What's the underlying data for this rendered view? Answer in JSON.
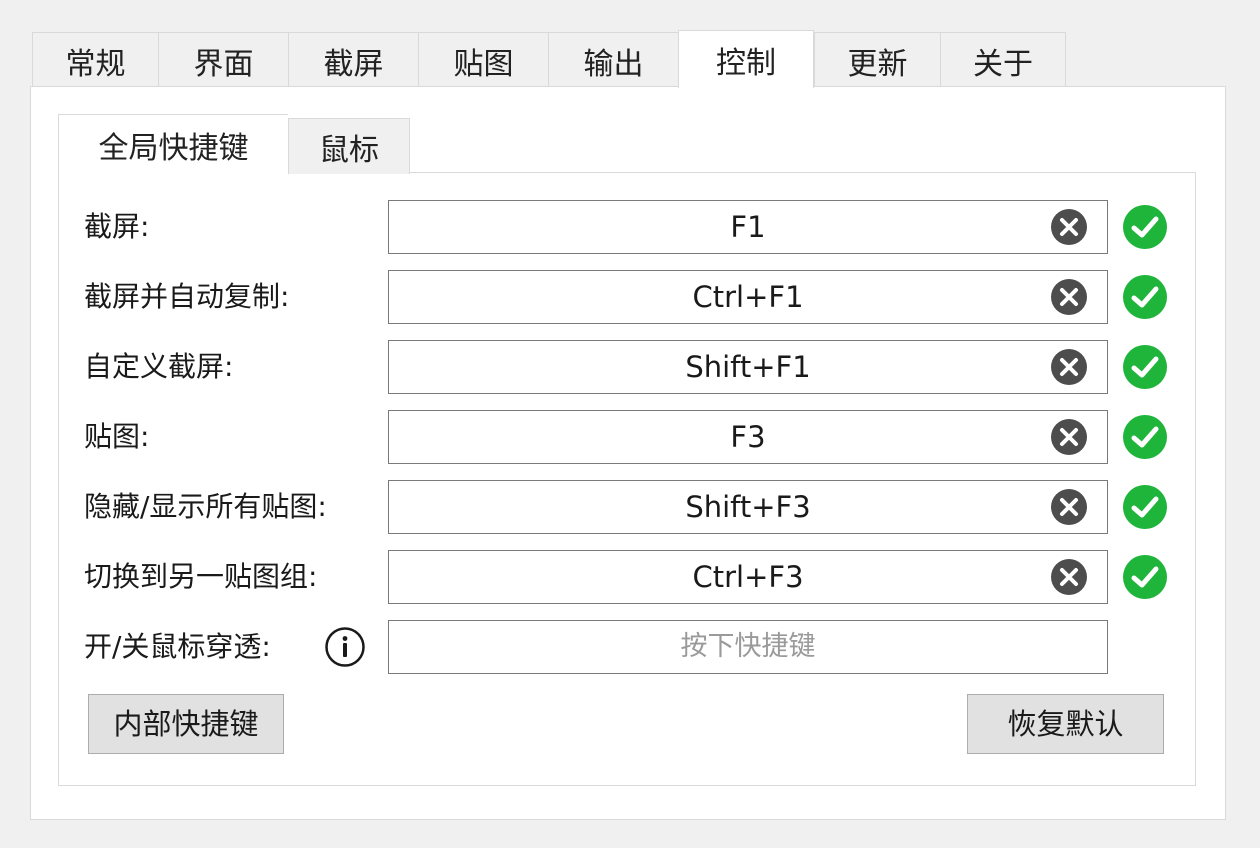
{
  "main_tabs": [
    "常规",
    "界面",
    "截屏",
    "贴图",
    "输出",
    "控制",
    "更新",
    "关于"
  ],
  "main_tab_active": "控制",
  "sub_tabs": [
    "全局快捷键",
    "鼠标"
  ],
  "sub_tab_active": "全局快捷键",
  "hotkeys": [
    {
      "label": "截屏:",
      "value": "F1",
      "has_clear": true,
      "status": "ok"
    },
    {
      "label": "截屏并自动复制:",
      "value": "Ctrl+F1",
      "has_clear": true,
      "status": "ok"
    },
    {
      "label": "自定义截屏:",
      "value": "Shift+F1",
      "has_clear": true,
      "status": "ok"
    },
    {
      "label": "贴图:",
      "value": "F3",
      "has_clear": true,
      "status": "ok"
    },
    {
      "label": "隐藏/显示所有贴图:",
      "value": "Shift+F3",
      "has_clear": true,
      "status": "ok"
    },
    {
      "label": "切换到另一贴图组:",
      "value": "Ctrl+F3",
      "has_clear": true,
      "status": "ok"
    },
    {
      "label": "开/关鼠标穿透:",
      "value": "",
      "placeholder": "按下快捷键",
      "has_info": true,
      "has_clear": false,
      "status": "none"
    }
  ],
  "buttons": {
    "internal_hotkeys": "内部快捷键",
    "restore_default": "恢复默认"
  },
  "colors": {
    "ok_green": "#1eb53a",
    "clear_gray": "#4d4d4d",
    "window_bg": "#f0f0f0",
    "panel_bg": "#ffffff",
    "button_bg": "#e1e1e1"
  },
  "icons": {
    "clear": "clear-x-circle-icon",
    "status_ok": "check-circle-icon",
    "info": "info-circle-icon"
  }
}
